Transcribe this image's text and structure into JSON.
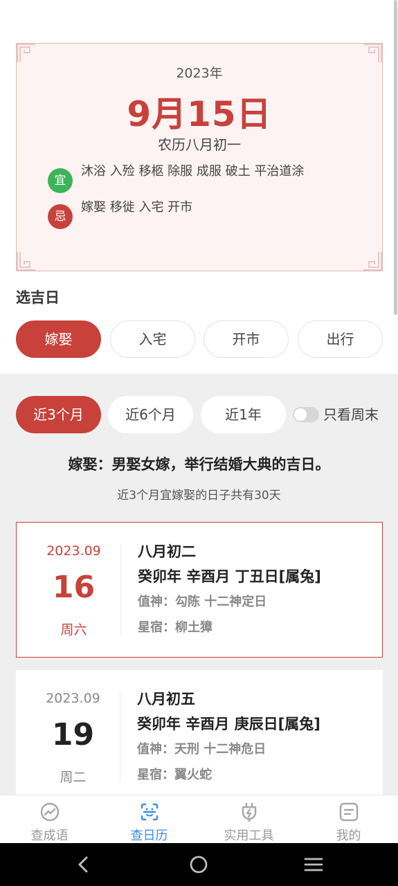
{
  "date_card": {
    "year": "2023年",
    "month_day": "9月15日",
    "lunar": "农历八月初一",
    "yi_badge": "宜",
    "yi_text": "沐浴 入殓 移柩 除服 成服 破土 平治道涂",
    "ji_badge": "忌",
    "ji_text": "嫁娶 移徙 入宅 开市"
  },
  "select_title": "选吉日",
  "categories": [
    {
      "label": "嫁娶",
      "active": true
    },
    {
      "label": "入宅",
      "active": false
    },
    {
      "label": "开市",
      "active": false
    },
    {
      "label": "出行",
      "active": false
    }
  ],
  "filters": [
    {
      "label": "近3个月",
      "active": true
    },
    {
      "label": "近6个月",
      "active": false
    },
    {
      "label": "近1年",
      "active": false
    }
  ],
  "weekend_toggle": {
    "label": "只看周末",
    "on": false
  },
  "description": "嫁娶：男娶女嫁，举行结婚大典的吉日。",
  "count_text": "近3个月宜嫁娶的日子共有30天",
  "days": [
    {
      "year_month": "2023.09",
      "day": "16",
      "weekday": "周六",
      "lunar": "八月初二",
      "ganzhi": "癸卯年 辛酉月 丁丑日[属兔]",
      "zhishen": "值神：勾陈   十二神定日",
      "xingxiu": "星宿：柳土獐",
      "selected": true
    },
    {
      "year_month": "2023.09",
      "day": "19",
      "weekday": "周二",
      "lunar": "八月初五",
      "ganzhi": "癸卯年 辛酉月 庚辰日[属兔]",
      "zhishen": "值神：天刑   十二神危日",
      "xingxiu": "星宿：翼火蛇",
      "selected": false
    }
  ],
  "tabbar": [
    {
      "label": "查成语",
      "icon": "trend-circle-icon",
      "active": false
    },
    {
      "label": "查日历",
      "icon": "calendar-face-icon",
      "active": true
    },
    {
      "label": "实用工具",
      "icon": "plug-bolt-icon",
      "active": false
    },
    {
      "label": "我的",
      "icon": "profile-card-icon",
      "active": false
    }
  ],
  "colors": {
    "accent_red": "#c8413b",
    "yi_green": "#3db35a",
    "tab_active_blue": "#3a8ee6"
  }
}
